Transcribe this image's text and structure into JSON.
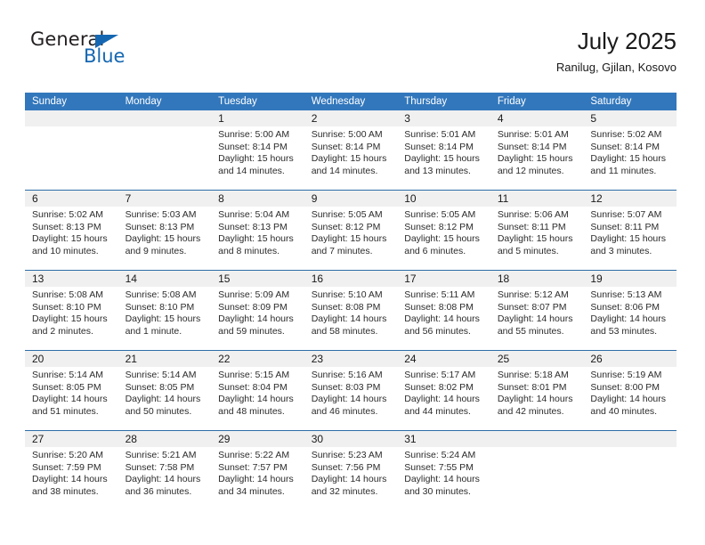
{
  "brand": {
    "name_dark": "General",
    "name_blue": "Blue",
    "triangle_color": "#1567b2"
  },
  "header": {
    "title": "July 2025",
    "location": "Ranilug, Gjilan, Kosovo",
    "header_bg": "#3277bc",
    "rule_color": "#2e6da8",
    "daynumber_bg": "#f0f0f0"
  },
  "weekdays": [
    "Sunday",
    "Monday",
    "Tuesday",
    "Wednesday",
    "Thursday",
    "Friday",
    "Saturday"
  ],
  "weeks": [
    [
      {
        "day": "",
        "lines": []
      },
      {
        "day": "",
        "lines": []
      },
      {
        "day": "1",
        "lines": [
          "Sunrise: 5:00 AM",
          "Sunset: 8:14 PM",
          "Daylight: 15 hours",
          "and 14 minutes."
        ]
      },
      {
        "day": "2",
        "lines": [
          "Sunrise: 5:00 AM",
          "Sunset: 8:14 PM",
          "Daylight: 15 hours",
          "and 14 minutes."
        ]
      },
      {
        "day": "3",
        "lines": [
          "Sunrise: 5:01 AM",
          "Sunset: 8:14 PM",
          "Daylight: 15 hours",
          "and 13 minutes."
        ]
      },
      {
        "day": "4",
        "lines": [
          "Sunrise: 5:01 AM",
          "Sunset: 8:14 PM",
          "Daylight: 15 hours",
          "and 12 minutes."
        ]
      },
      {
        "day": "5",
        "lines": [
          "Sunrise: 5:02 AM",
          "Sunset: 8:14 PM",
          "Daylight: 15 hours",
          "and 11 minutes."
        ]
      }
    ],
    [
      {
        "day": "6",
        "lines": [
          "Sunrise: 5:02 AM",
          "Sunset: 8:13 PM",
          "Daylight: 15 hours",
          "and 10 minutes."
        ]
      },
      {
        "day": "7",
        "lines": [
          "Sunrise: 5:03 AM",
          "Sunset: 8:13 PM",
          "Daylight: 15 hours",
          "and 9 minutes."
        ]
      },
      {
        "day": "8",
        "lines": [
          "Sunrise: 5:04 AM",
          "Sunset: 8:13 PM",
          "Daylight: 15 hours",
          "and 8 minutes."
        ]
      },
      {
        "day": "9",
        "lines": [
          "Sunrise: 5:05 AM",
          "Sunset: 8:12 PM",
          "Daylight: 15 hours",
          "and 7 minutes."
        ]
      },
      {
        "day": "10",
        "lines": [
          "Sunrise: 5:05 AM",
          "Sunset: 8:12 PM",
          "Daylight: 15 hours",
          "and 6 minutes."
        ]
      },
      {
        "day": "11",
        "lines": [
          "Sunrise: 5:06 AM",
          "Sunset: 8:11 PM",
          "Daylight: 15 hours",
          "and 5 minutes."
        ]
      },
      {
        "day": "12",
        "lines": [
          "Sunrise: 5:07 AM",
          "Sunset: 8:11 PM",
          "Daylight: 15 hours",
          "and 3 minutes."
        ]
      }
    ],
    [
      {
        "day": "13",
        "lines": [
          "Sunrise: 5:08 AM",
          "Sunset: 8:10 PM",
          "Daylight: 15 hours",
          "and 2 minutes."
        ]
      },
      {
        "day": "14",
        "lines": [
          "Sunrise: 5:08 AM",
          "Sunset: 8:10 PM",
          "Daylight: 15 hours",
          "and 1 minute."
        ]
      },
      {
        "day": "15",
        "lines": [
          "Sunrise: 5:09 AM",
          "Sunset: 8:09 PM",
          "Daylight: 14 hours",
          "and 59 minutes."
        ]
      },
      {
        "day": "16",
        "lines": [
          "Sunrise: 5:10 AM",
          "Sunset: 8:08 PM",
          "Daylight: 14 hours",
          "and 58 minutes."
        ]
      },
      {
        "day": "17",
        "lines": [
          "Sunrise: 5:11 AM",
          "Sunset: 8:08 PM",
          "Daylight: 14 hours",
          "and 56 minutes."
        ]
      },
      {
        "day": "18",
        "lines": [
          "Sunrise: 5:12 AM",
          "Sunset: 8:07 PM",
          "Daylight: 14 hours",
          "and 55 minutes."
        ]
      },
      {
        "day": "19",
        "lines": [
          "Sunrise: 5:13 AM",
          "Sunset: 8:06 PM",
          "Daylight: 14 hours",
          "and 53 minutes."
        ]
      }
    ],
    [
      {
        "day": "20",
        "lines": [
          "Sunrise: 5:14 AM",
          "Sunset: 8:05 PM",
          "Daylight: 14 hours",
          "and 51 minutes."
        ]
      },
      {
        "day": "21",
        "lines": [
          "Sunrise: 5:14 AM",
          "Sunset: 8:05 PM",
          "Daylight: 14 hours",
          "and 50 minutes."
        ]
      },
      {
        "day": "22",
        "lines": [
          "Sunrise: 5:15 AM",
          "Sunset: 8:04 PM",
          "Daylight: 14 hours",
          "and 48 minutes."
        ]
      },
      {
        "day": "23",
        "lines": [
          "Sunrise: 5:16 AM",
          "Sunset: 8:03 PM",
          "Daylight: 14 hours",
          "and 46 minutes."
        ]
      },
      {
        "day": "24",
        "lines": [
          "Sunrise: 5:17 AM",
          "Sunset: 8:02 PM",
          "Daylight: 14 hours",
          "and 44 minutes."
        ]
      },
      {
        "day": "25",
        "lines": [
          "Sunrise: 5:18 AM",
          "Sunset: 8:01 PM",
          "Daylight: 14 hours",
          "and 42 minutes."
        ]
      },
      {
        "day": "26",
        "lines": [
          "Sunrise: 5:19 AM",
          "Sunset: 8:00 PM",
          "Daylight: 14 hours",
          "and 40 minutes."
        ]
      }
    ],
    [
      {
        "day": "27",
        "lines": [
          "Sunrise: 5:20 AM",
          "Sunset: 7:59 PM",
          "Daylight: 14 hours",
          "and 38 minutes."
        ]
      },
      {
        "day": "28",
        "lines": [
          "Sunrise: 5:21 AM",
          "Sunset: 7:58 PM",
          "Daylight: 14 hours",
          "and 36 minutes."
        ]
      },
      {
        "day": "29",
        "lines": [
          "Sunrise: 5:22 AM",
          "Sunset: 7:57 PM",
          "Daylight: 14 hours",
          "and 34 minutes."
        ]
      },
      {
        "day": "30",
        "lines": [
          "Sunrise: 5:23 AM",
          "Sunset: 7:56 PM",
          "Daylight: 14 hours",
          "and 32 minutes."
        ]
      },
      {
        "day": "31",
        "lines": [
          "Sunrise: 5:24 AM",
          "Sunset: 7:55 PM",
          "Daylight: 14 hours",
          "and 30 minutes."
        ]
      },
      {
        "day": "",
        "lines": []
      },
      {
        "day": "",
        "lines": []
      }
    ]
  ]
}
